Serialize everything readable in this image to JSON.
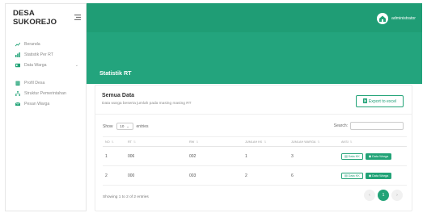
{
  "brand": {
    "name": "DESA SUKOREJO",
    "toggle_icon": "hamburger-icon"
  },
  "sidebar": {
    "items": [
      {
        "label": "Beranda",
        "icon": "chart-line-icon"
      },
      {
        "label": "Statistik Per RT",
        "icon": "bar-chart-icon"
      },
      {
        "label": "Data Warga",
        "icon": "id-card-icon",
        "caret": "⌄"
      },
      {
        "label": "Profil Desa",
        "icon": "building-icon"
      },
      {
        "label": "Struktur Pemerintahan",
        "icon": "sitemap-icon"
      },
      {
        "label": "Pesan Warga",
        "icon": "envelope-icon"
      }
    ]
  },
  "header": {
    "user": "administrator",
    "accent": "#1f9d75"
  },
  "page": {
    "title": "Statistik RT"
  },
  "card": {
    "title": "Semua Data",
    "subtitle": "Data warga beserta jumlah pada masing masing RT",
    "export_label": "Export to excel"
  },
  "table_controls": {
    "show_label": "Show",
    "entries_value": "10",
    "entries_label": "entries",
    "search_label": "Search:"
  },
  "table": {
    "columns": [
      "NO",
      "RT",
      "RW",
      "JUMLAH KK",
      "JUMLAH WARGA",
      "AKSI"
    ],
    "rows": [
      {
        "no": "1",
        "rt": "006",
        "rw": "002",
        "jumlah_kk": "1",
        "jumlah_warga": "3",
        "btn_kk": "Data KK",
        "btn_warga": "Data Warga"
      },
      {
        "no": "2",
        "rt": "000",
        "rw": "003",
        "jumlah_kk": "2",
        "jumlah_warga": "6",
        "btn_kk": "Data KK",
        "btn_warga": "Data Warga"
      }
    ]
  },
  "footer": {
    "info": "Showing 1 to 2 of 2 entries",
    "prev": "‹",
    "current_page": "1",
    "next": "›"
  }
}
